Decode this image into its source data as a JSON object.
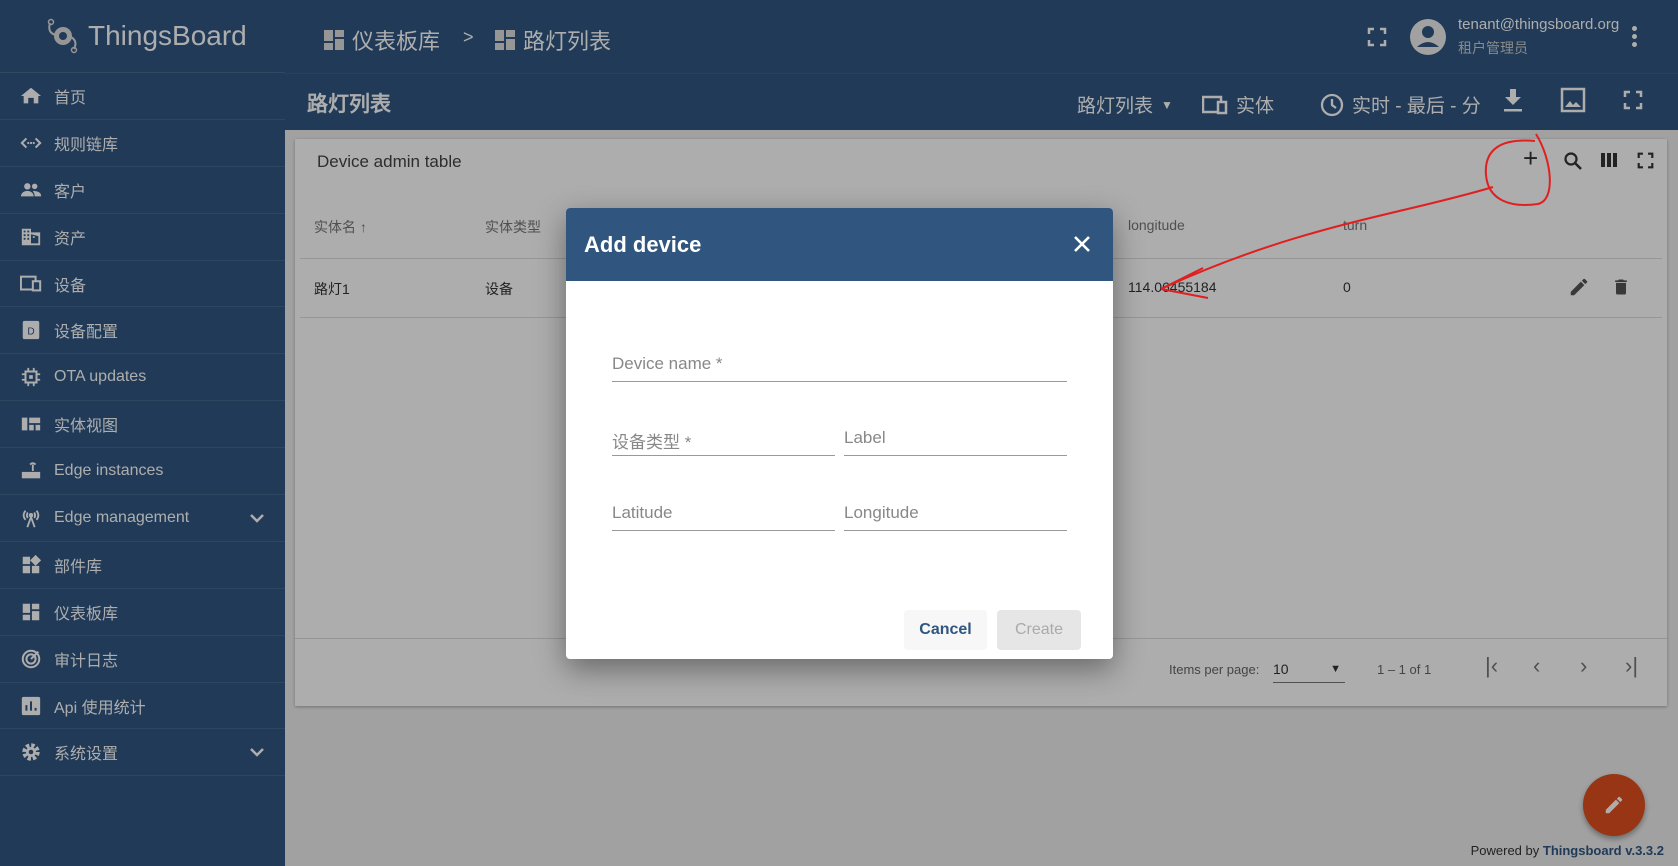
{
  "brand": {
    "name": "ThingsBoard"
  },
  "sidebar": {
    "items": [
      {
        "label": "首页",
        "icon": "home-icon"
      },
      {
        "label": "规则链库",
        "icon": "code-arrows-icon"
      },
      {
        "label": "客户",
        "icon": "people-icon"
      },
      {
        "label": "资产",
        "icon": "domain-icon"
      },
      {
        "label": "设备",
        "icon": "devices-icon"
      },
      {
        "label": "设备配置",
        "icon": "device-profile-icon"
      },
      {
        "label": "OTA updates",
        "icon": "chip-icon"
      },
      {
        "label": "实体视图",
        "icon": "view-quilt-icon"
      },
      {
        "label": "Edge instances",
        "icon": "router-icon"
      },
      {
        "label": "Edge management",
        "icon": "antenna-icon",
        "expandable": true
      },
      {
        "label": "部件库",
        "icon": "widgets-icon"
      },
      {
        "label": "仪表板库",
        "icon": "dashboard-icon"
      },
      {
        "label": "审计日志",
        "icon": "track-changes-icon"
      },
      {
        "label": "Api 使用统计",
        "icon": "insert-chart-icon"
      },
      {
        "label": "系统设置",
        "icon": "settings-icon",
        "expandable": true
      }
    ]
  },
  "header": {
    "breadcrumb": [
      "仪表板库",
      "路灯列表"
    ],
    "separator": ">",
    "user": {
      "email": "tenant@thingsboard.org",
      "role": "租户管理员"
    }
  },
  "dashboard_bar": {
    "title": "路灯列表",
    "state_select": "路灯列表",
    "entities_label": "实体",
    "timewindow": "实时 - 最后 - 分"
  },
  "widget": {
    "title": "Device admin table",
    "columns": [
      "实体名",
      "实体类型",
      "longitude",
      "turn"
    ],
    "rows": [
      {
        "name": "路灯1",
        "type": "设备",
        "longitude": "114.06455184",
        "turn": "0"
      }
    ],
    "paginator": {
      "items_per_page_label": "Items per page:",
      "items_per_page": "10",
      "range": "1 – 1 of 1"
    }
  },
  "dialog": {
    "title": "Add device",
    "fields": {
      "device_name": "Device name *",
      "device_type": "设备类型 *",
      "label": "Label",
      "latitude": "Latitude",
      "longitude": "Longitude"
    },
    "cancel": "Cancel",
    "create": "Create"
  },
  "footer": {
    "powered_by": "Powered by",
    "version_link": "Thingsboard v.3.3.2"
  },
  "colors": {
    "primary": "#305680",
    "fab": "#e04e1e",
    "annotation": "#e02020"
  }
}
